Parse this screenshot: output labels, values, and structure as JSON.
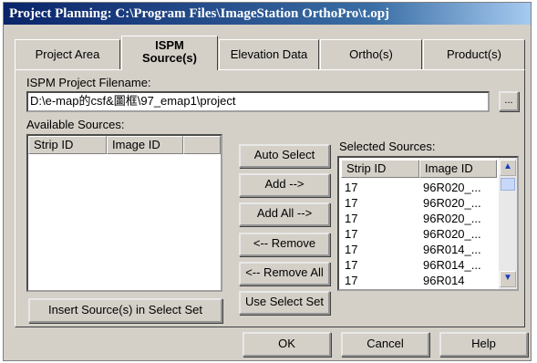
{
  "window": {
    "title": "Project Planning: C:\\Program Files\\ImageStation OrthoPro\\t.opj"
  },
  "tabs": [
    {
      "label": "Project Area"
    },
    {
      "label_line1": "ISPM",
      "label_line2": "Source(s)"
    },
    {
      "label": "Elevation Data"
    },
    {
      "label": "Ortho(s)"
    },
    {
      "label": "Product(s)"
    }
  ],
  "filename": {
    "label": "ISPM Project Filename:",
    "value": "D:\\e-map的csf&圖框\\97_emap1\\project",
    "browse_label": "..."
  },
  "available": {
    "label": "Available Sources:",
    "columns": [
      "Strip ID",
      "Image ID"
    ],
    "rows": [],
    "insert_button": "Insert Source(s) in Select Set"
  },
  "actions": {
    "auto_select": "Auto Select",
    "add": "Add -->",
    "add_all": "Add All -->",
    "remove": "<-- Remove",
    "remove_all": "<-- Remove All",
    "use_select_set": "Use Select Set"
  },
  "selected": {
    "label": "Selected Sources:",
    "columns": [
      "Strip ID",
      "Image ID"
    ],
    "rows": [
      [
        "17",
        "96R020_..."
      ],
      [
        "17",
        "96R020_..."
      ],
      [
        "17",
        "96R020_..."
      ],
      [
        "17",
        "96R020_..."
      ],
      [
        "17",
        "96R014_..."
      ],
      [
        "17",
        "96R014_..."
      ],
      [
        "17",
        "96R014"
      ]
    ]
  },
  "footer": {
    "ok": "OK",
    "cancel": "Cancel",
    "help": "Help"
  },
  "icons": {
    "scroll_up": "▲",
    "scroll_down": "▼"
  }
}
